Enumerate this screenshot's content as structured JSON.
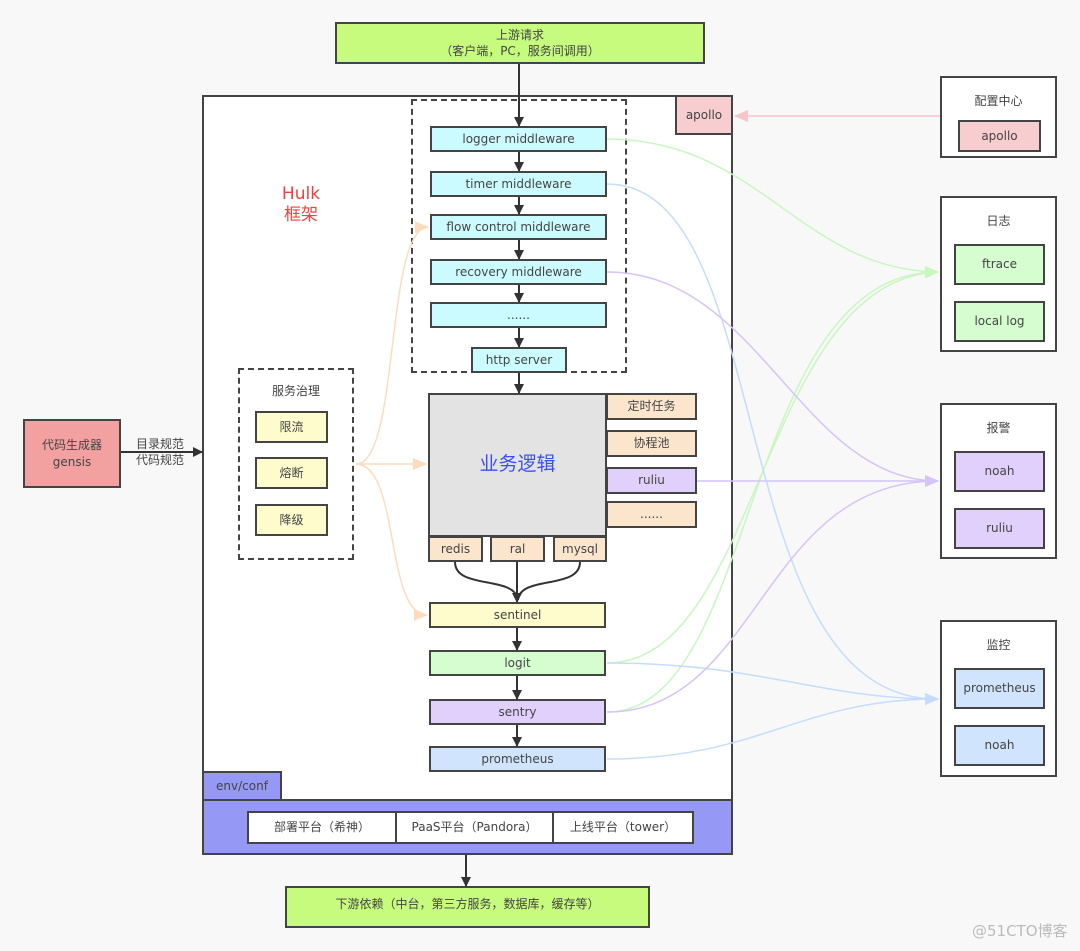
{
  "upstream": {
    "line1": "上游请求",
    "line2": "（客户端，PC，服务间调用）"
  },
  "downstream": {
    "label": "下游依赖（中台，第三方服务，数据库，缓存等）"
  },
  "framework": {
    "title_line1": "Hulk",
    "title_line2": "框架",
    "apollo": "apollo",
    "env_conf": "env/conf"
  },
  "middlewares": [
    "logger middleware",
    "timer middleware",
    "flow control middleware",
    "recovery middleware",
    "......"
  ],
  "http_server": "http server",
  "business_logic": "业务逻辑",
  "side_components": [
    "定时任务",
    "协程池",
    "ruliu",
    "......"
  ],
  "data_clients": [
    "redis",
    "ral",
    "mysql"
  ],
  "pipeline": [
    "sentinel",
    "logit",
    "sentry",
    "prometheus"
  ],
  "governance": {
    "title": "服务治理",
    "items": [
      "限流",
      "熔断",
      "降级"
    ]
  },
  "codegen": {
    "line1": "代码生成器",
    "line2": "gensis",
    "arrow_label1": "目录规范",
    "arrow_label2": "代码规范"
  },
  "platforms": [
    "部署平台（希神）",
    "PaaS平台（Pandora）",
    "上线平台（tower）"
  ],
  "right_panels": {
    "config": {
      "title": "配置中心",
      "items": [
        "apollo"
      ]
    },
    "log": {
      "title": "日志",
      "items": [
        "ftrace",
        "local log"
      ]
    },
    "alert": {
      "title": "报警",
      "items": [
        "noah",
        "ruliu"
      ]
    },
    "monitor": {
      "title": "监控",
      "items": [
        "prometheus",
        "noah"
      ]
    }
  },
  "watermark": "@51CTO博客",
  "colors": {
    "green_line": "#c8f7c0",
    "blue_line": "#c6dcfb",
    "purple_line": "#d6c4f7",
    "orange_line": "#fcdcbd",
    "pink_line": "#f7c4c8",
    "title_red": "#f04040",
    "biz_blue": "#3a4ff0"
  }
}
